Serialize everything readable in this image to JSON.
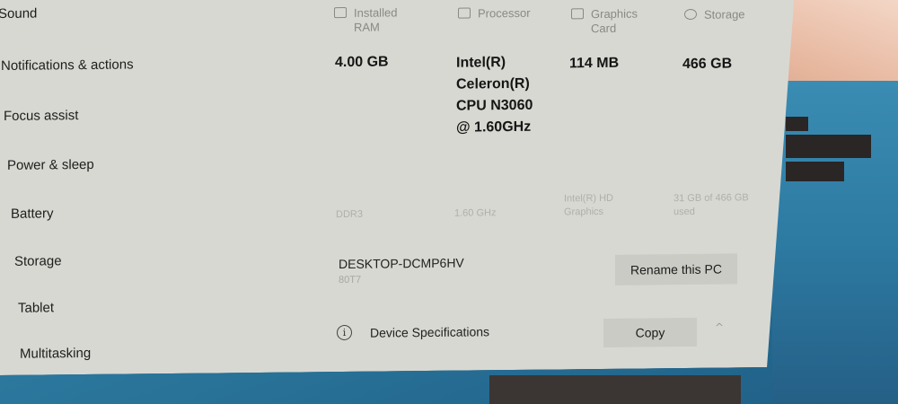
{
  "nav": {
    "items": [
      {
        "label": "Sound",
        "icon": "speaker-icon"
      },
      {
        "label": "Notifications & actions",
        "icon": "notification-icon"
      },
      {
        "label": "Focus assist",
        "icon": "moon-icon"
      },
      {
        "label": "Power & sleep",
        "icon": "power-icon"
      },
      {
        "label": "Battery",
        "icon": "battery-icon"
      },
      {
        "label": "Storage",
        "icon": "storage-icon"
      },
      {
        "label": "Tablet",
        "icon": "tablet-icon"
      },
      {
        "label": "Multitasking",
        "icon": "multitasking-icon"
      }
    ]
  },
  "specs": {
    "ram": {
      "heading": "Installed RAM",
      "value": "4.00 GB",
      "sub": "DDR3"
    },
    "processor": {
      "heading": "Processor",
      "value": "Intel(R) Celeron(R) CPU N3060 @ 1.60GHz",
      "sub": "1.60 GHz"
    },
    "graphics": {
      "heading": "Graphics Card",
      "value": "114 MB",
      "sub": "Intel(R) HD Graphics"
    },
    "storage": {
      "heading": "Storage",
      "value": "466 GB",
      "sub": "31 GB of 466 GB used"
    }
  },
  "device": {
    "name": "DESKTOP-DCMP6HV",
    "model": "80T7",
    "rename_label": "Rename this PC"
  },
  "specifications": {
    "label": "Device Specifications",
    "copy_label": "Copy",
    "info_glyph": "i",
    "chevron_glyph": "^"
  }
}
